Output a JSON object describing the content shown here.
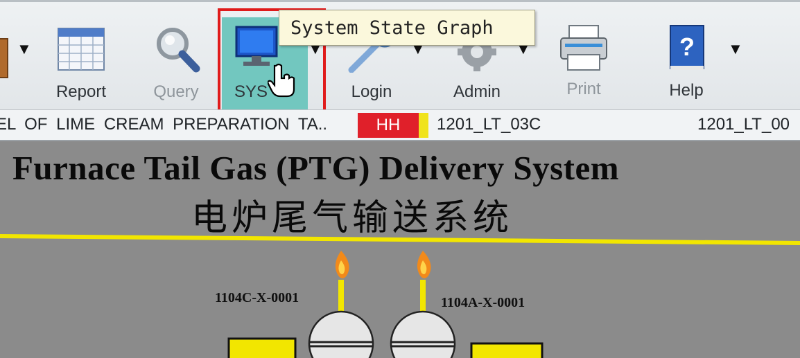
{
  "toolbar": {
    "buttons": [
      {
        "label": "Report",
        "icon": "report-calendar-icon",
        "dimmed": false
      },
      {
        "label": "Query",
        "icon": "magnifier-icon",
        "dimmed": true
      },
      {
        "label": "SYS",
        "icon": "monitor-icon",
        "dimmed": false,
        "active": true
      },
      {
        "label": "Login",
        "icon": "key-icon",
        "dimmed": false
      },
      {
        "label": "Admin",
        "icon": "gear-icon",
        "dimmed": false
      },
      {
        "label": "Print",
        "icon": "printer-icon",
        "dimmed": true
      },
      {
        "label": "Help",
        "icon": "help-book-icon",
        "dimmed": false
      }
    ],
    "tooltip": "System State Graph",
    "dropdown_glyph": "▼"
  },
  "alarm_bar": {
    "description": "EL OF LIME CREAM PREPARATION TA..",
    "level": "HH",
    "tag": "1201_LT_03C",
    "next_tag": "1201_LT_00"
  },
  "display": {
    "title_en": "Furnace Tail Gas (PTG) Delivery System",
    "title_cn": "电炉尾气输送系统",
    "equipment": [
      {
        "tag": "1104C-X-0001"
      },
      {
        "tag": "1104A-X-0001"
      }
    ]
  },
  "colors": {
    "accent_active": "#72c7bf",
    "alarm_red": "#e0202a",
    "alarm_yellow": "#f0e31c",
    "highlight_red": "#e01b1b",
    "pipe_yellow": "#f2e600",
    "tooltip_bg": "#fbf8dc"
  }
}
